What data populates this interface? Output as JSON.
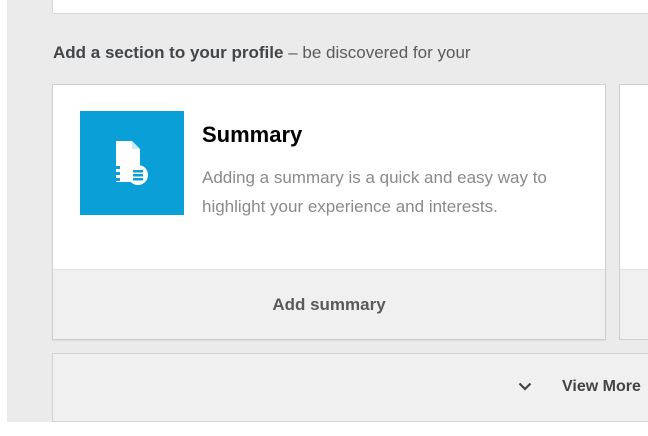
{
  "section": {
    "heading_bold": "Add a section to your profile",
    "heading_rest": " – be discovered for your"
  },
  "summary_card": {
    "title": "Summary",
    "description": "Adding a summary is a quick and easy way to highlight your experience and interests.",
    "action_label": "Add summary",
    "icon": "summary-document-icon",
    "icon_bg": "#0b9fd8"
  },
  "view_more": {
    "label": "View More",
    "icon": "chevron-down-icon"
  }
}
